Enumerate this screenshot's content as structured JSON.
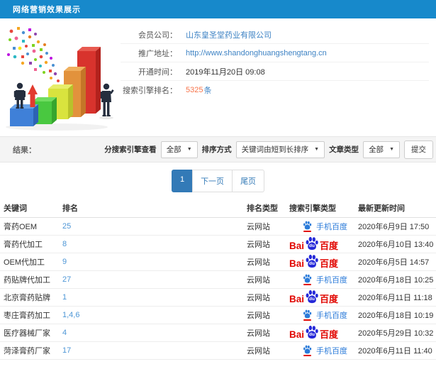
{
  "header": {
    "title": "网络营销效果展示"
  },
  "info": {
    "rows": [
      {
        "label": "会员公司：",
        "value": "山东皇圣堂药业有限公司",
        "type": "link"
      },
      {
        "label": "推广地址：",
        "value": "http://www.shandonghuangshengtang.cn",
        "type": "link"
      },
      {
        "label": "开通时间：",
        "value": "2019年11月20日 09:08",
        "type": "text"
      },
      {
        "label": "搜索引擎排名：",
        "value": "5325",
        "suffix": "条",
        "type": "highlight"
      }
    ]
  },
  "filter": {
    "result_label": "结果：",
    "groups": [
      {
        "label": "分搜索引擎查看",
        "value": "全部"
      },
      {
        "label": "排序方式",
        "value": "关键词由短到长排序"
      },
      {
        "label": "文章类型",
        "value": "全部"
      }
    ],
    "submit_label": "提交"
  },
  "pagination": {
    "items": [
      {
        "label": "1",
        "active": true
      },
      {
        "label": "下一页",
        "active": false
      },
      {
        "label": "尾页",
        "active": false
      }
    ]
  },
  "table": {
    "headers": [
      "关键词",
      "排名",
      "排名类型",
      "搜索引擎类型",
      "最新更新时间"
    ],
    "baidu_logo": {
      "prefix": "Bai",
      "paw_text": "du",
      "suffix": "百度"
    },
    "rows": [
      {
        "keyword": "膏药OEM",
        "rank": "25",
        "rank_type": "云网站",
        "engine": "mobile-baidu",
        "engine_text": "手机百度",
        "updated": "2020年6月9日 17:50"
      },
      {
        "keyword": "膏药代加工",
        "rank": "8",
        "rank_type": "云网站",
        "engine": "baidu",
        "engine_text": "Baidu百度",
        "updated": "2020年6月10日 13:40"
      },
      {
        "keyword": "OEM代加工",
        "rank": "9",
        "rank_type": "云网站",
        "engine": "baidu",
        "engine_text": "Baidu百度",
        "updated": "2020年6月5日 14:57"
      },
      {
        "keyword": "药贴牌代加工",
        "rank": "27",
        "rank_type": "云网站",
        "engine": "mobile-baidu",
        "engine_text": "手机百度",
        "updated": "2020年6月18日 10:25"
      },
      {
        "keyword": "北京膏药贴牌",
        "rank": "1",
        "rank_type": "云网站",
        "engine": "baidu",
        "engine_text": "Baidu百度",
        "updated": "2020年6月11日 11:18"
      },
      {
        "keyword": "枣庄膏药加工",
        "rank": "1,4,6",
        "rank_type": "云网站",
        "engine": "mobile-baidu",
        "engine_text": "手机百度",
        "updated": "2020年6月18日 10:19"
      },
      {
        "keyword": "医疗器械厂家",
        "rank": "4",
        "rank_type": "云网站",
        "engine": "baidu",
        "engine_text": "Baidu百度",
        "updated": "2020年5月29日 10:32"
      },
      {
        "keyword": "菏泽膏药厂家",
        "rank": "17",
        "rank_type": "云网站",
        "engine": "mobile-baidu",
        "engine_text": "手机百度",
        "updated": "2020年6月11日 11:40"
      }
    ]
  },
  "colors": {
    "header_blue": "#1789cb",
    "link_blue": "#3e83c4",
    "rank_blue": "#4d96d6",
    "highlight_orange": "#f7744a",
    "pagination_blue": "#337ab7",
    "baidu_red": "#e10601",
    "baidu_paw_blue": "#2529d8",
    "mobile_baidu_blue": "#2b7bd9"
  }
}
